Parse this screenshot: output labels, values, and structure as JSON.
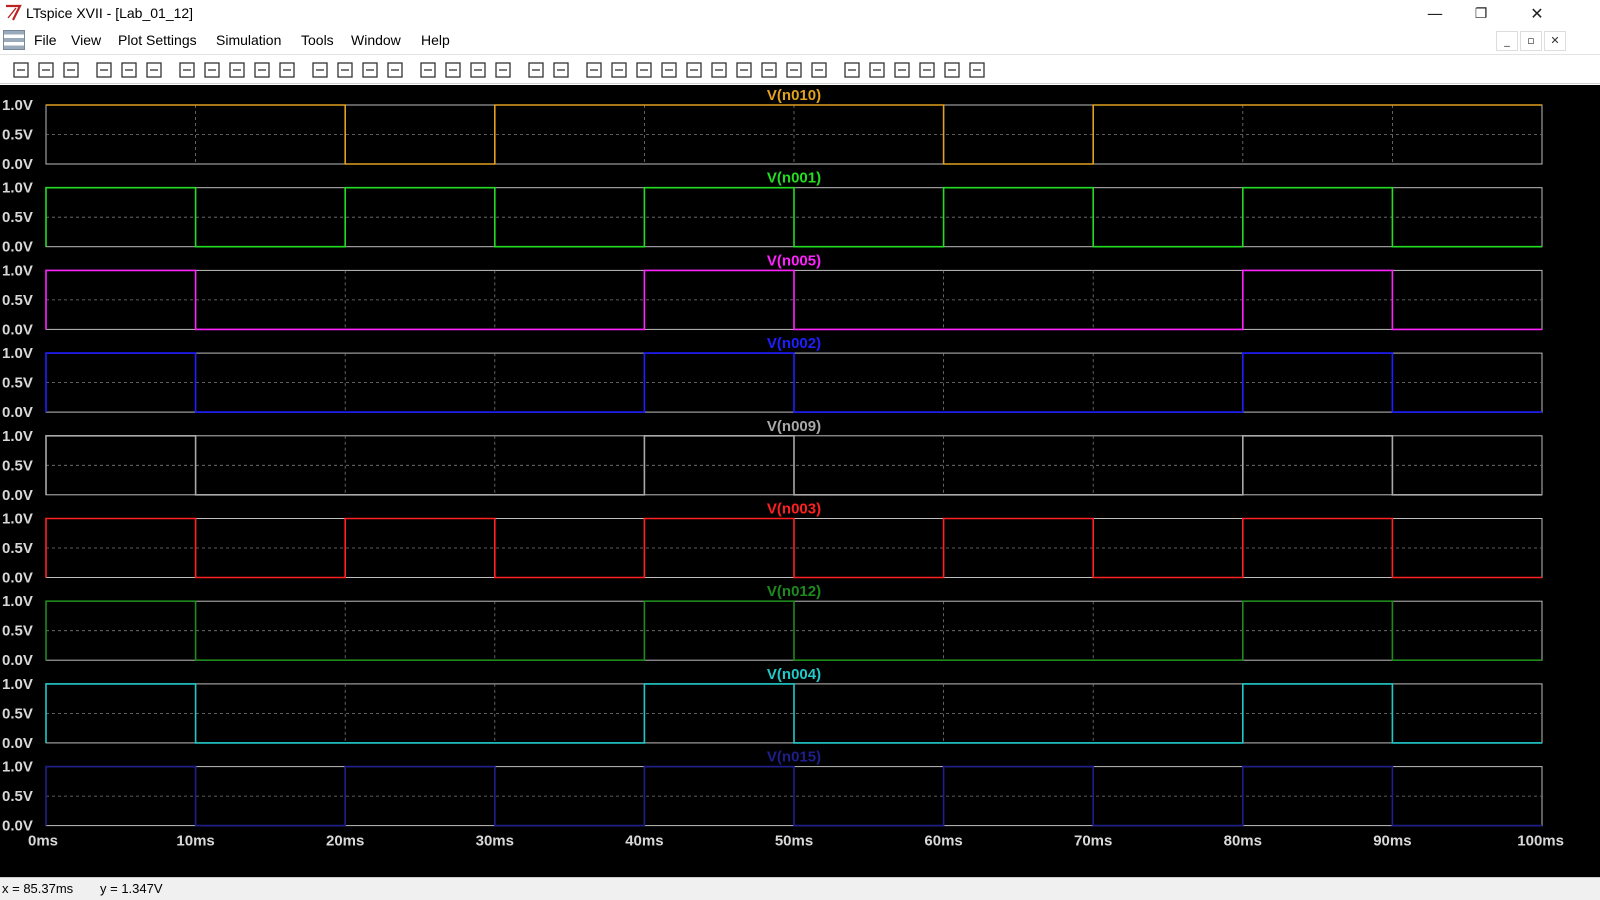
{
  "window": {
    "title": "LTspice XVII - [Lab_01_12]",
    "minimize": "—",
    "restore": "❐",
    "close": "✕"
  },
  "menu": {
    "items": [
      "File",
      "View",
      "Plot Settings",
      "Simulation",
      "Tools",
      "Window",
      "Help"
    ]
  },
  "mdi": {
    "minimize": "_",
    "restore": "▫",
    "close": "✕"
  },
  "toolbar": {
    "buttons": [
      "new-icon",
      "open-icon",
      "save-icon",
      "control-panel-icon",
      "run-icon",
      "halt-icon",
      "zoom-in-icon",
      "zoom-area-icon",
      "zoom-out-icon",
      "zoom-fit-icon",
      "autorange-icon",
      "grid-icon",
      "tile-vertical-icon",
      "tile-horizontal-icon",
      "cascade-icon",
      "cut-icon",
      "copy-icon",
      "paste-icon",
      "find-icon",
      "print-icon",
      "print-preview-icon",
      "wire-icon",
      "ground-icon",
      "label-icon",
      "resistor-icon",
      "capacitor-icon",
      "inductor-icon",
      "diode-icon",
      "component-icon",
      "move-icon",
      "drag-icon",
      "undo-icon",
      "redo-icon",
      "rotate-icon",
      "mirror-icon",
      "text-icon",
      "spice-directive-icon"
    ]
  },
  "status": {
    "x_readout": "x = 85.37ms",
    "y_readout": "y = 1.347V"
  },
  "chart_data": {
    "type": "line",
    "xlabel": "",
    "xlim": [
      0,
      100
    ],
    "x_unit": "ms",
    "x_ticks": [
      "0ms",
      "10ms",
      "20ms",
      "30ms",
      "40ms",
      "50ms",
      "60ms",
      "70ms",
      "80ms",
      "90ms",
      "100ms"
    ],
    "y_ticks": [
      "1.0V",
      "0.5V",
      "0.0V"
    ],
    "ylim": [
      0,
      1
    ],
    "grid": true,
    "panes": [
      {
        "name": "V(n010)",
        "color": "#e0a020",
        "points": [
          [
            0,
            1
          ],
          [
            20,
            1
          ],
          [
            20,
            0
          ],
          [
            30,
            0
          ],
          [
            30,
            1
          ],
          [
            60,
            1
          ],
          [
            60,
            0
          ],
          [
            70,
            0
          ],
          [
            70,
            1
          ],
          [
            100,
            1
          ]
        ]
      },
      {
        "name": "V(n001)",
        "color": "#22dd22",
        "points": [
          [
            0,
            0
          ],
          [
            0,
            1
          ],
          [
            10,
            1
          ],
          [
            10,
            0
          ],
          [
            20,
            0
          ],
          [
            20,
            1
          ],
          [
            30,
            1
          ],
          [
            30,
            0
          ],
          [
            40,
            0
          ],
          [
            40,
            1
          ],
          [
            50,
            1
          ],
          [
            50,
            0
          ],
          [
            60,
            0
          ],
          [
            60,
            1
          ],
          [
            70,
            1
          ],
          [
            70,
            0
          ],
          [
            80,
            0
          ],
          [
            80,
            1
          ],
          [
            90,
            1
          ],
          [
            90,
            0
          ],
          [
            100,
            0
          ]
        ]
      },
      {
        "name": "V(n005)",
        "color": "#ff22ff",
        "points": [
          [
            0,
            0
          ],
          [
            0,
            1
          ],
          [
            10,
            1
          ],
          [
            10,
            0
          ],
          [
            40,
            0
          ],
          [
            40,
            1
          ],
          [
            50,
            1
          ],
          [
            50,
            0
          ],
          [
            80,
            0
          ],
          [
            80,
            1
          ],
          [
            90,
            1
          ],
          [
            90,
            0
          ],
          [
            100,
            0
          ]
        ]
      },
      {
        "name": "V(n002)",
        "color": "#1e1eff",
        "points": [
          [
            0,
            0
          ],
          [
            0,
            1
          ],
          [
            10,
            1
          ],
          [
            10,
            0
          ],
          [
            40,
            0
          ],
          [
            40,
            1
          ],
          [
            50,
            1
          ],
          [
            50,
            0
          ],
          [
            80,
            0
          ],
          [
            80,
            1
          ],
          [
            90,
            1
          ],
          [
            90,
            0
          ],
          [
            100,
            0
          ]
        ]
      },
      {
        "name": "V(n009)",
        "color": "#a8a8a8",
        "points": [
          [
            0,
            0
          ],
          [
            0,
            1
          ],
          [
            10,
            1
          ],
          [
            10,
            0
          ],
          [
            40,
            0
          ],
          [
            40,
            1
          ],
          [
            50,
            1
          ],
          [
            50,
            0
          ],
          [
            80,
            0
          ],
          [
            80,
            1
          ],
          [
            90,
            1
          ],
          [
            90,
            0
          ],
          [
            100,
            0
          ]
        ]
      },
      {
        "name": "V(n003)",
        "color": "#ff2020",
        "points": [
          [
            0,
            0
          ],
          [
            0,
            1
          ],
          [
            10,
            1
          ],
          [
            10,
            0
          ],
          [
            20,
            0
          ],
          [
            20,
            1
          ],
          [
            30,
            1
          ],
          [
            30,
            0
          ],
          [
            40,
            0
          ],
          [
            40,
            1
          ],
          [
            50,
            1
          ],
          [
            50,
            0
          ],
          [
            60,
            0
          ],
          [
            60,
            1
          ],
          [
            70,
            1
          ],
          [
            70,
            0
          ],
          [
            80,
            0
          ],
          [
            80,
            1
          ],
          [
            90,
            1
          ],
          [
            90,
            0
          ],
          [
            100,
            0
          ]
        ]
      },
      {
        "name": "V(n012)",
        "color": "#1e8a1e",
        "points": [
          [
            0,
            0
          ],
          [
            0,
            1
          ],
          [
            10,
            1
          ],
          [
            10,
            0
          ],
          [
            40,
            0
          ],
          [
            40,
            1
          ],
          [
            50,
            1
          ],
          [
            50,
            0
          ],
          [
            80,
            0
          ],
          [
            80,
            1
          ],
          [
            90,
            1
          ],
          [
            90,
            0
          ],
          [
            100,
            0
          ]
        ]
      },
      {
        "name": "V(n004)",
        "color": "#20c8c8",
        "points": [
          [
            0,
            0
          ],
          [
            0,
            1
          ],
          [
            10,
            1
          ],
          [
            10,
            0
          ],
          [
            40,
            0
          ],
          [
            40,
            1
          ],
          [
            50,
            1
          ],
          [
            50,
            0
          ],
          [
            80,
            0
          ],
          [
            80,
            1
          ],
          [
            90,
            1
          ],
          [
            90,
            0
          ],
          [
            100,
            0
          ]
        ]
      },
      {
        "name": "V(n015)",
        "color": "#1e1e8c",
        "points": [
          [
            0,
            0
          ],
          [
            0,
            1
          ],
          [
            10,
            1
          ],
          [
            10,
            0
          ],
          [
            20,
            0
          ],
          [
            20,
            1
          ],
          [
            30,
            1
          ],
          [
            30,
            0
          ],
          [
            40,
            0
          ],
          [
            40,
            1
          ],
          [
            50,
            1
          ],
          [
            50,
            0
          ],
          [
            60,
            0
          ],
          [
            60,
            1
          ],
          [
            70,
            1
          ],
          [
            70,
            0
          ],
          [
            80,
            0
          ],
          [
            80,
            1
          ],
          [
            90,
            1
          ],
          [
            90,
            0
          ],
          [
            100,
            0
          ]
        ]
      }
    ]
  }
}
